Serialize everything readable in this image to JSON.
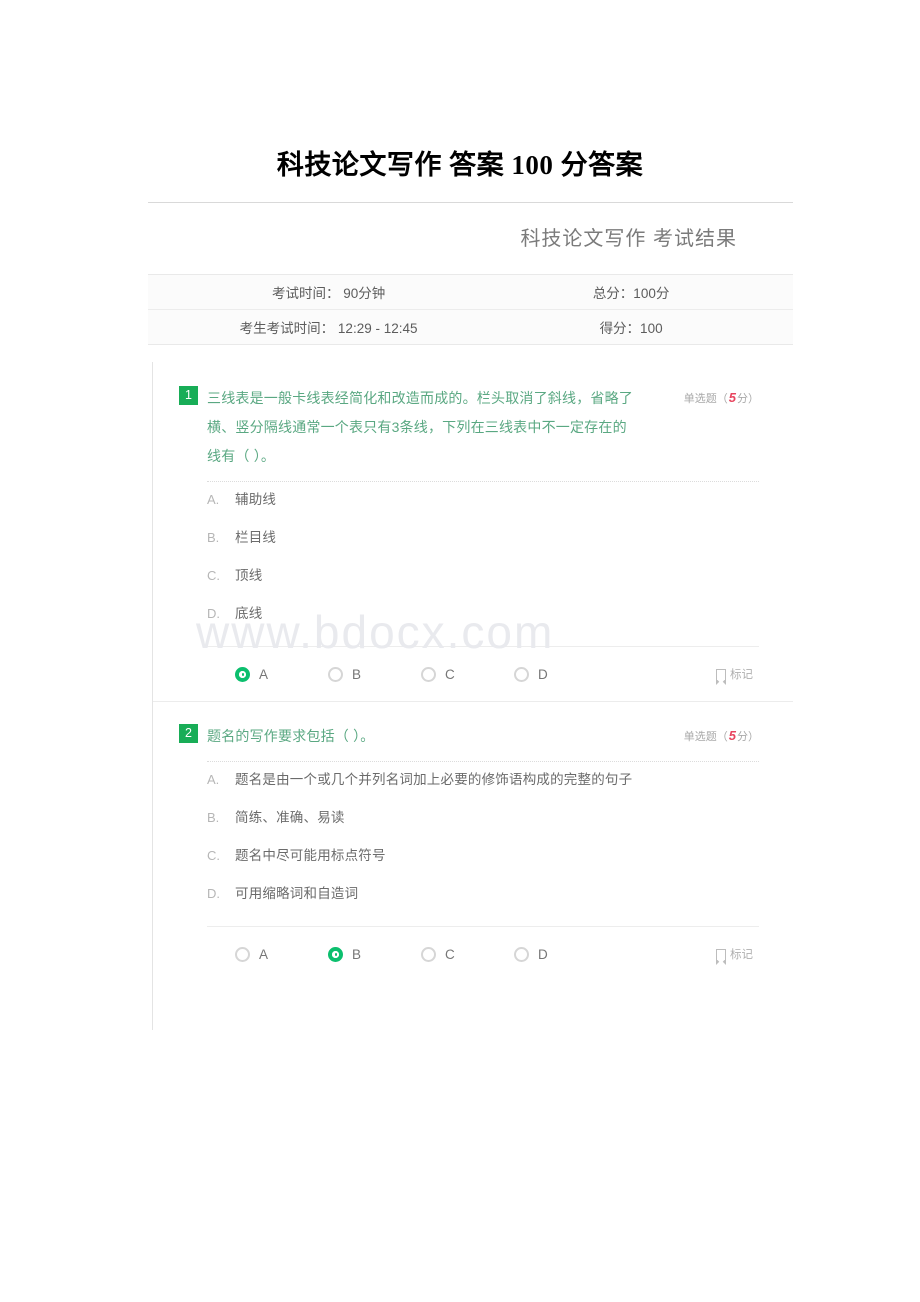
{
  "document": {
    "title": "科技论文写作 答案 100 分答案"
  },
  "watermark": "www.bdocx.com",
  "exam": {
    "result_header": "科技论文写作 考试结果",
    "info": [
      {
        "left": "考试时间： 90分钟",
        "right": "总分：100分"
      },
      {
        "left": "考生考试时间： 12:29 - 12:45",
        "right": "得分：100"
      }
    ]
  },
  "questions": [
    {
      "number": "1",
      "stem": "三线表是一般卡线表经简化和改造而成的。栏头取消了斜线，省略了横、竖分隔线通常一个表只有3条线，下列在三线表中不一定存在的线有（ ）。",
      "type_label": "单选题（",
      "points": "5",
      "points_suffix": "分）",
      "options": [
        {
          "key": "A.",
          "text": "辅助线"
        },
        {
          "key": "B.",
          "text": "栏目线"
        },
        {
          "key": "C.",
          "text": "顶线"
        },
        {
          "key": "D.",
          "text": "底线"
        }
      ],
      "choices": [
        {
          "label": "A",
          "selected": true
        },
        {
          "label": "B",
          "selected": false
        },
        {
          "label": "C",
          "selected": false
        },
        {
          "label": "D",
          "selected": false
        }
      ],
      "mark_label": "标记"
    },
    {
      "number": "2",
      "stem": "题名的写作要求包括（ ）。",
      "type_label": "单选题（",
      "points": "5",
      "points_suffix": "分）",
      "options": [
        {
          "key": "A.",
          "text": "题名是由一个或几个并列名词加上必要的修饰语构成的完整的句子"
        },
        {
          "key": "B.",
          "text": "简练、准确、易读"
        },
        {
          "key": "C.",
          "text": "题名中尽可能用标点符号"
        },
        {
          "key": "D.",
          "text": "可用缩略词和自造词"
        }
      ],
      "choices": [
        {
          "label": "A",
          "selected": false
        },
        {
          "label": "B",
          "selected": true
        },
        {
          "label": "C",
          "selected": false
        },
        {
          "label": "D",
          "selected": false
        }
      ],
      "mark_label": "标记"
    }
  ],
  "colors": {
    "brand_green": "#18ad57",
    "radio_green": "#0cbf6e",
    "points_red": "#e8455f",
    "stem_green": "#5aa882"
  }
}
